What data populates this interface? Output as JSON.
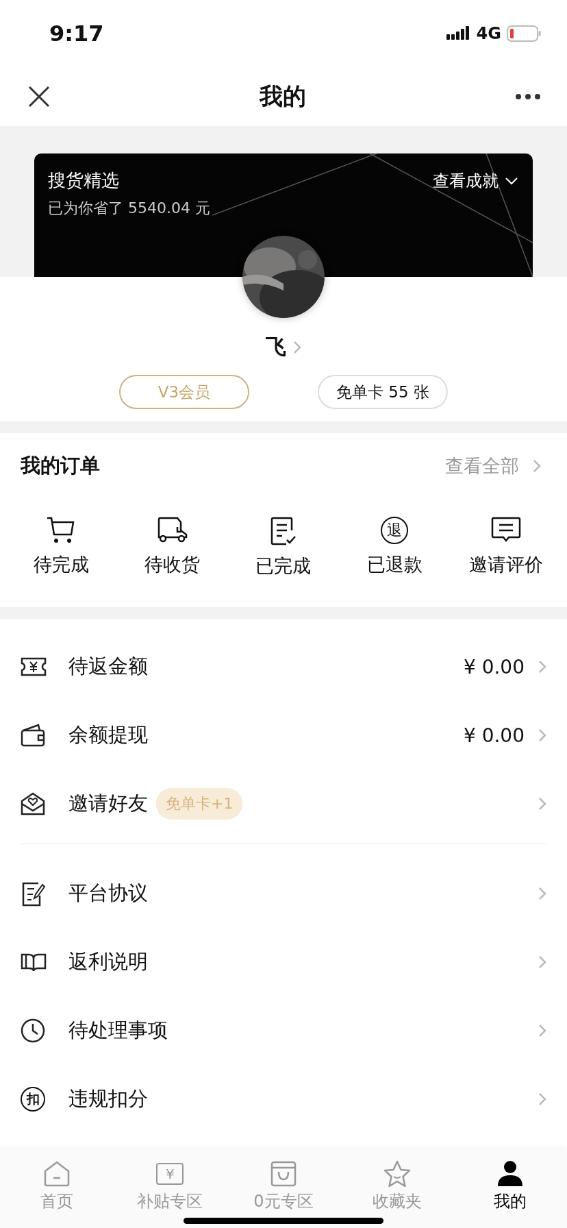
{
  "status_bar": {
    "time": "9:17",
    "network": "4G"
  },
  "nav": {
    "title": "我的"
  },
  "profile": {
    "brand": "搜货精选",
    "savings": "已为你省了 5540.04 元",
    "achievements": "查看成就",
    "name": "飞",
    "badges": [
      {
        "label": "V3会员",
        "kind": "member"
      },
      {
        "label": "免单卡 55 张",
        "kind": "card"
      }
    ]
  },
  "orders": {
    "title": "我的订单",
    "view_all": "查看全部",
    "items": [
      {
        "label": "待完成"
      },
      {
        "label": "待收货"
      },
      {
        "label": "已完成"
      },
      {
        "label": "已退款",
        "icon_text": "退"
      },
      {
        "label": "邀请评价"
      }
    ]
  },
  "menu_groups": [
    [
      {
        "label": "待返金额",
        "value": "¥ 0.00"
      },
      {
        "label": "余额提现",
        "value": "¥ 0.00"
      },
      {
        "label": "邀请好友",
        "tag": "免单卡+1"
      }
    ],
    [
      {
        "label": "平台协议"
      },
      {
        "label": "返利说明"
      },
      {
        "label": "待处理事项"
      },
      {
        "label": "违规扣分",
        "icon_text": "扣"
      }
    ]
  ],
  "tab_bar": [
    {
      "label": "首页",
      "selected": false
    },
    {
      "label": "补贴专区",
      "selected": false,
      "icon_text": "¥"
    },
    {
      "label": "0元专区",
      "selected": false
    },
    {
      "label": "收藏夹",
      "selected": false
    },
    {
      "label": "我的",
      "selected": true
    }
  ]
}
